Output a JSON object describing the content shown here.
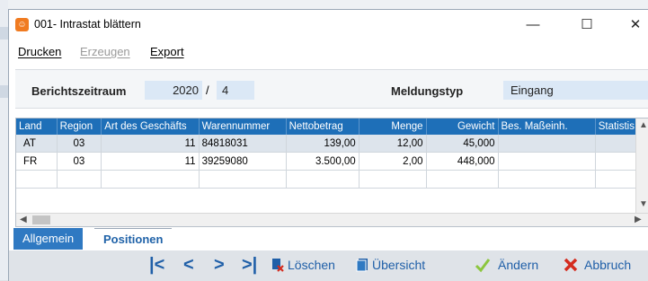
{
  "window": {
    "title": "001- Intrastat blättern",
    "app_icon": "sage-icon"
  },
  "menu": {
    "print": "Drucken",
    "create": "Erzeugen",
    "export": "Export"
  },
  "header": {
    "period_label": "Berichtszeitraum",
    "period_year": "2020",
    "period_sep": "/",
    "period_month": "4",
    "type_label": "Meldungstyp",
    "type_value": "Eingang"
  },
  "grid": {
    "columns": [
      "Land",
      "Region",
      "Art des Geschäfts",
      "Warennummer",
      "Nettobetrag",
      "Menge",
      "Gewicht",
      "Bes. Maßeinh.",
      "Statistis"
    ],
    "rows": [
      [
        "AT",
        "03",
        "11",
        "84818031",
        "139,00",
        "12,00",
        "45,000",
        "",
        ""
      ],
      [
        "FR",
        "03",
        "11",
        "39259080",
        "3.500,00",
        "2,00",
        "448,000",
        "",
        ""
      ]
    ]
  },
  "tabs": {
    "general": "Allgemein",
    "positions": "Positionen"
  },
  "actions": {
    "delete": "Löschen",
    "overview": "Übersicht",
    "change": "Ändern",
    "cancel": "Abbruch"
  },
  "colors": {
    "accent": "#1e6fb8",
    "orange": "#f07b21"
  }
}
